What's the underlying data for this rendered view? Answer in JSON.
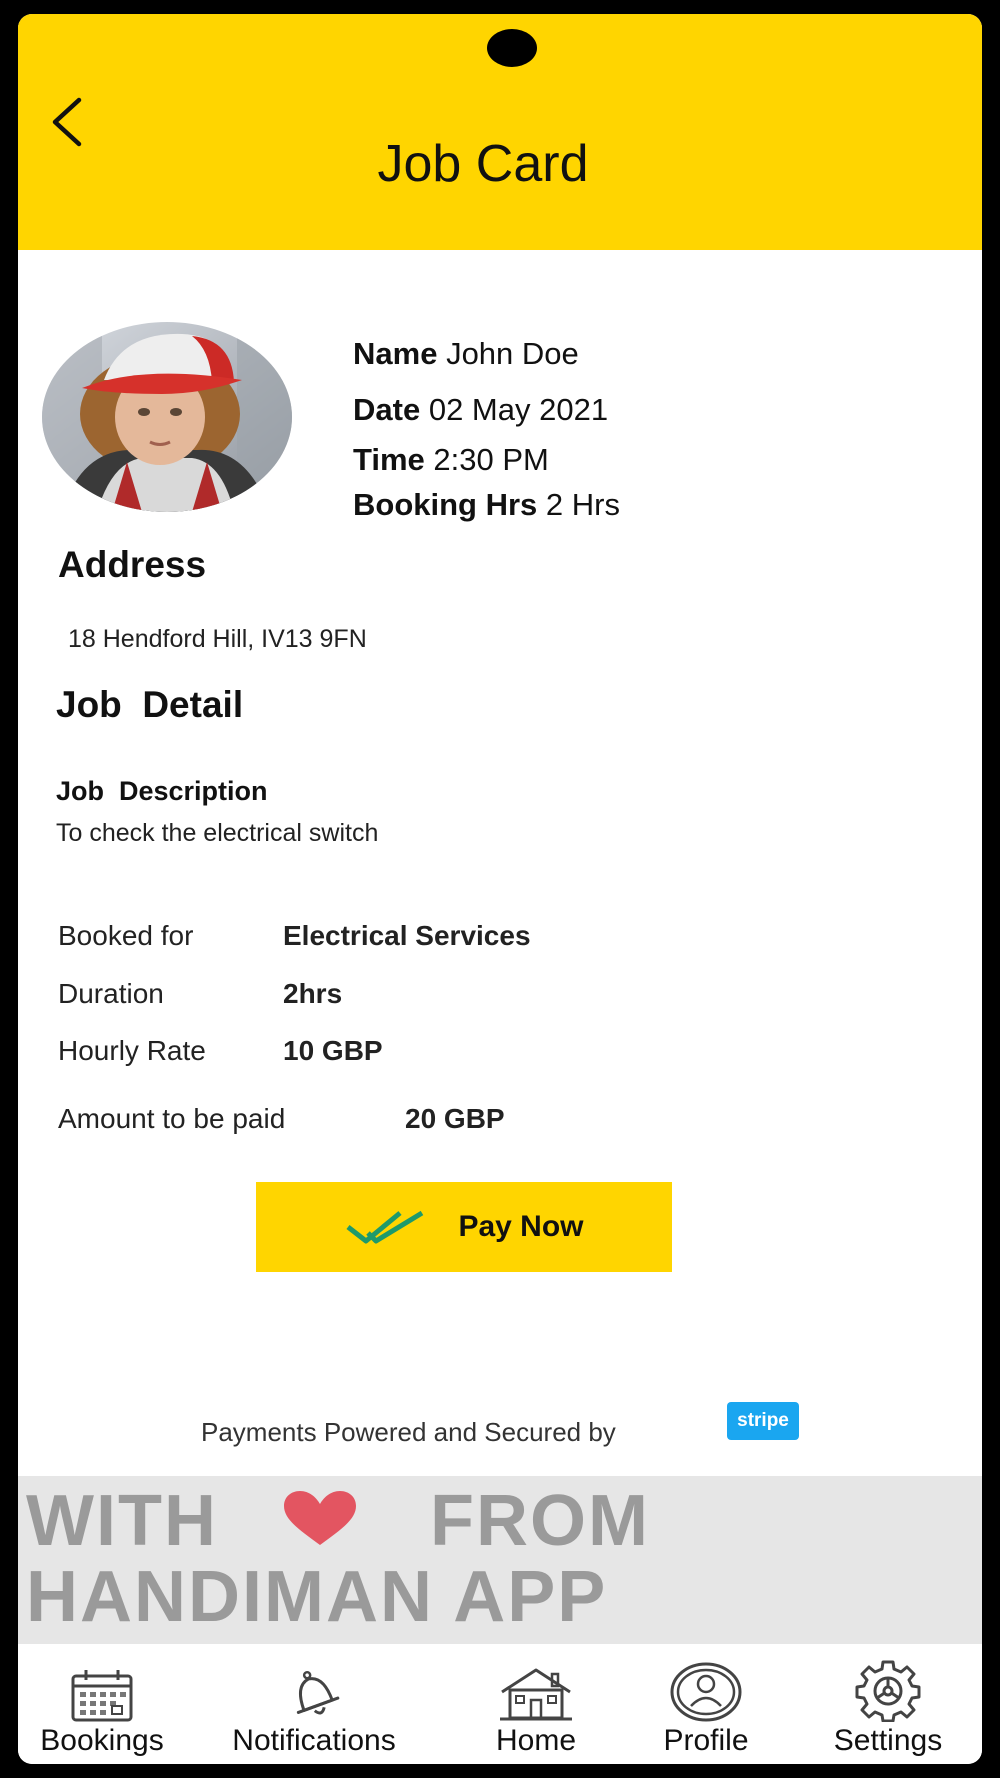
{
  "header": {
    "title": "Job Card",
    "background_color": "#FFD500",
    "back_icon": "chevron-left-icon"
  },
  "profile": {
    "avatar_icon": "user-avatar-photo",
    "name_label": "Name",
    "name_value": "John Doe",
    "date_label": "Date",
    "date_value": "02 May 2021",
    "time_label": "Time",
    "time_value": "2:30 PM",
    "hours_label": "Booking Hrs",
    "hours_value": "2 Hrs"
  },
  "address": {
    "heading": "Address",
    "text": "18 Hendford Hill, IV13 9FN"
  },
  "job_detail": {
    "heading": "Job  Detail",
    "description_label": "Job  Description",
    "description_text": "To check the electrical switch",
    "rows": [
      {
        "label": "Booked for",
        "value": "Electrical Services"
      },
      {
        "label": "Duration",
        "value": "2hrs"
      },
      {
        "label": "Hourly Rate",
        "value": "10 GBP"
      },
      {
        "label": "Amount to be paid",
        "value": "20 GBP"
      }
    ]
  },
  "pay_button": {
    "label": "Pay Now",
    "icon": "double-check-icon",
    "color": "#FFD500"
  },
  "payment_notice": {
    "text": "Payments Powered and Secured by",
    "badge": "stripe",
    "badge_color": "#1AA6F0"
  },
  "banner": {
    "line1_left": "WITH",
    "line1_right": "FROM",
    "line2": "HANDIMAN APP",
    "heart_icon": "heart-icon",
    "heart_color": "#E35561"
  },
  "bottom_nav": {
    "items": [
      {
        "label": "Bookings",
        "icon": "calendar-icon"
      },
      {
        "label": "Notifications",
        "icon": "bell-icon"
      },
      {
        "label": "Home",
        "icon": "house-icon"
      },
      {
        "label": "Profile",
        "icon": "user-circle-icon"
      },
      {
        "label": "Settings",
        "icon": "gear-icon"
      }
    ]
  }
}
